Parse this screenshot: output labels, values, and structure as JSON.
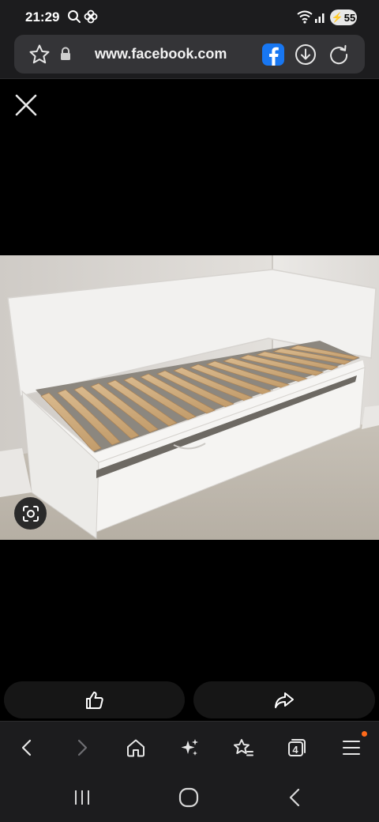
{
  "status_bar": {
    "time": "21:29",
    "battery": "55",
    "icons": [
      "search-icon",
      "pinwheel-icon",
      "wifi-icon",
      "signal-icon",
      "battery-charging-icon"
    ]
  },
  "browser": {
    "url": "www.facebook.com",
    "icons": [
      "star-outline-icon",
      "lock-icon",
      "facebook-icon",
      "download-icon",
      "reload-icon"
    ]
  },
  "viewer": {
    "close_icon": "close-icon",
    "lens_icon": "visual-search-icon",
    "photo_subject": "white single day bed with trundle drawer and wooden slats"
  },
  "actions": {
    "like_icon": "thumbs-up-icon",
    "share_icon": "share-arrow-icon"
  },
  "toolbar": {
    "tab_count": "4",
    "icons": [
      "back-icon",
      "forward-icon",
      "home-icon",
      "sparkle-icon",
      "bookmarks-icon",
      "tabs-icon",
      "menu-icon"
    ]
  },
  "system_nav": {
    "icons": [
      "recents-icon",
      "home-circle-icon",
      "back-chevron-icon"
    ]
  },
  "colors": {
    "bar_bg": "#1c1c1e",
    "url_pill": "#343437",
    "facebook_blue": "#1877f2",
    "notification": "#ff6a1a"
  }
}
